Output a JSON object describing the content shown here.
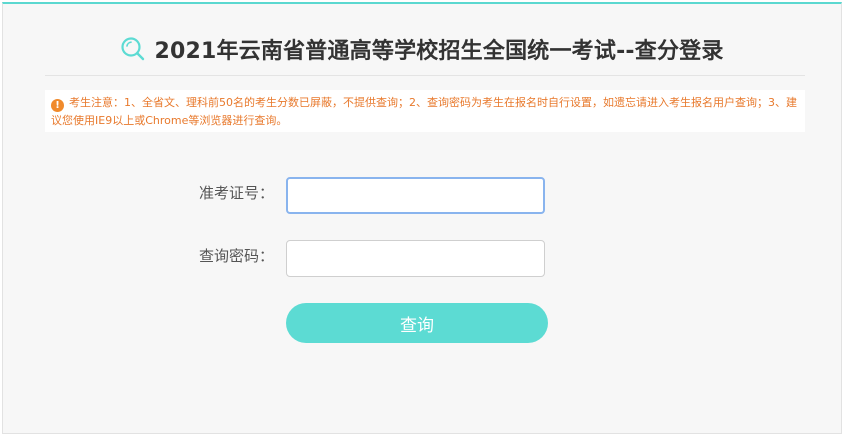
{
  "page": {
    "title": "2021年云南省普通高等学校招生全国统一考试--查分登录"
  },
  "notice": {
    "icon": "exclamation-icon",
    "text": "考生注意：1、全省文、理科前50名的考生分数已屏蔽，不提供查询；2、查询密码为考生在报名时自行设置，如遗忘请进入考生报名用户查询；3、建议您使用IE9以上或Chrome等浏览器进行查询。"
  },
  "form": {
    "exam_number_label": "准考证号：",
    "password_label": "查询密码：",
    "exam_number_value": "",
    "password_value": "",
    "submit_label": "查询"
  },
  "colors": {
    "accent": "#5cdbd3",
    "notice_text": "#e8792c",
    "title_text": "#333333"
  }
}
